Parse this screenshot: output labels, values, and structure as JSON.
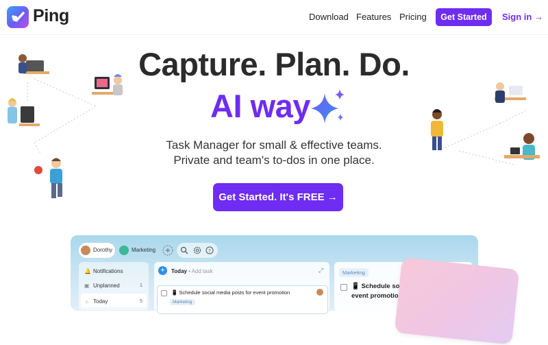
{
  "nav": {
    "brand": "Ping",
    "links": [
      "Download",
      "Features",
      "Pricing"
    ],
    "cta": "Get Started",
    "signin": "Sign in →"
  },
  "colors": {
    "accent": "#6f2cf3",
    "heading": "#2b2b2b"
  },
  "hero": {
    "headline": "Capture. Plan. Do.",
    "headline_accent": "AI way",
    "subtitle_line1": "Task Manager for small & effective teams.",
    "subtitle_line2": "Private and team's to-dos in one place.",
    "cta": "Get Started. It's FREE →"
  },
  "app_preview": {
    "workspace_tabs": [
      "Dorothy",
      "Marketing"
    ],
    "toolbar_icons": [
      "add-icon",
      "search-icon",
      "gear-icon",
      "help-icon"
    ],
    "sidebar": [
      {
        "icon": "bell-icon",
        "label": "Notifications",
        "count": ""
      },
      {
        "icon": "calendar-icon",
        "label": "Unplanned",
        "count": "1"
      },
      {
        "icon": "sun-icon",
        "label": "Today",
        "count": "5"
      }
    ],
    "today_panel": {
      "title": "Today",
      "add_placeholder": "Add task",
      "task": "📱 Schedule social media posts for event promotion",
      "task_tag": "Marketing"
    },
    "detail_panel": {
      "tag": "Marketing",
      "title_line1": "📱 Schedule soc",
      "title_line2": "event promotio"
    }
  }
}
